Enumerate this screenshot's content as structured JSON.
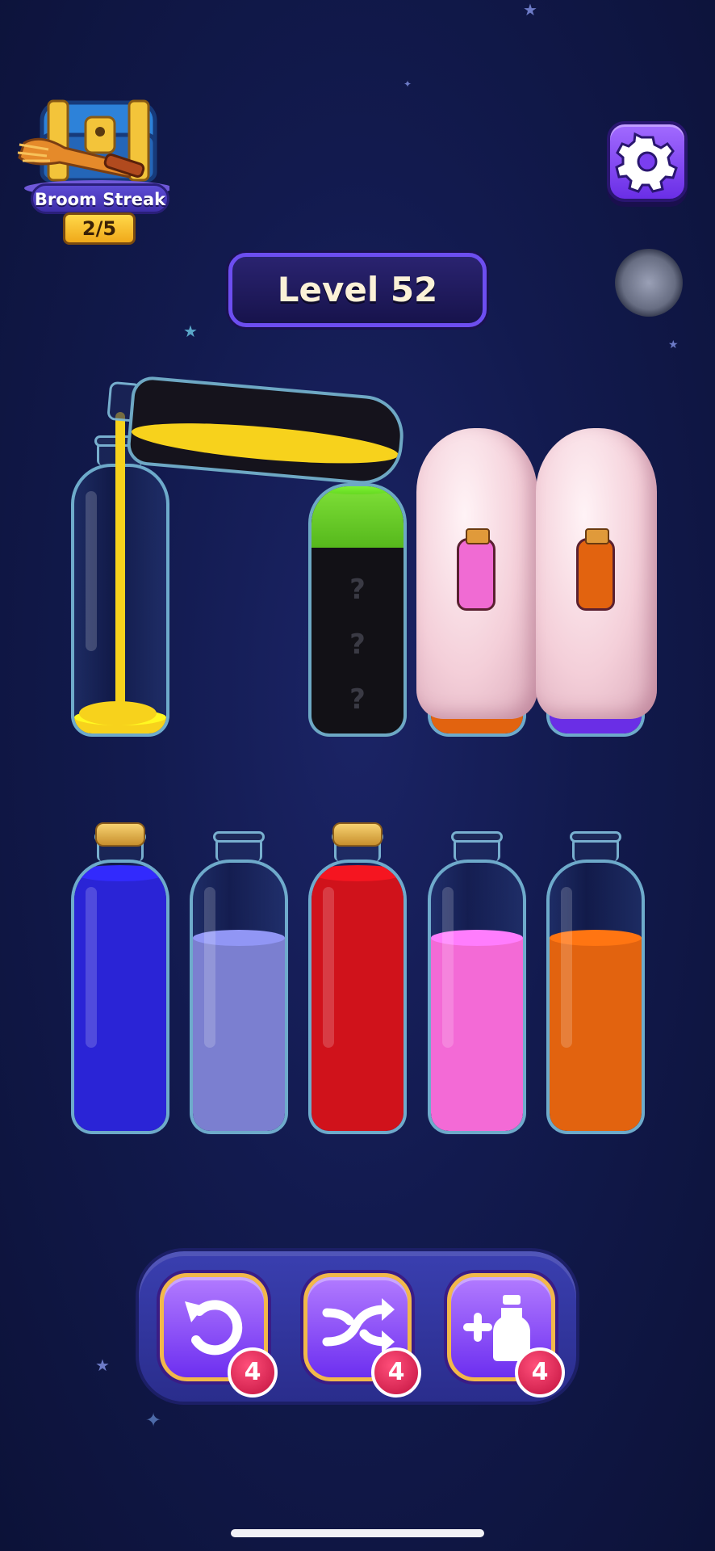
{
  "streak": {
    "title": "Broom Streak",
    "count": "2/5"
  },
  "level": {
    "label": "Level 52"
  },
  "icons": {
    "settings": "gear-icon",
    "streak": "treasure-chest-icon",
    "undo": "undo-icon",
    "shuffle": "shuffle-icon",
    "add_bottle": "add-bottle-icon"
  },
  "boosters": [
    {
      "name": "undo",
      "count": "4"
    },
    {
      "name": "shuffle",
      "count": "4"
    },
    {
      "name": "add-bottle",
      "count": "4"
    }
  ],
  "hidden_marks": [
    "?",
    "?",
    "?"
  ],
  "bottles_top": [
    {
      "id": "pour-target",
      "liquid": "#f7d21c",
      "fill": 0.05
    },
    {
      "id": "mystery",
      "liquid": "#6cd02b",
      "fill": 0.25
    },
    {
      "id": "covered-pink",
      "hint_color": "#f06bd3"
    },
    {
      "id": "covered-orange",
      "hint_color": "#e2630f"
    }
  ],
  "bottles_bottom": [
    {
      "id": "blue",
      "liquid": "#2a24d6",
      "fill": 1.0,
      "corked": true
    },
    {
      "id": "lavender",
      "liquid": "#7b7fd0",
      "fill": 0.75,
      "corked": false
    },
    {
      "id": "red",
      "liquid": "#d0121b",
      "fill": 1.0,
      "corked": true
    },
    {
      "id": "pink",
      "liquid": "#f36ad6",
      "fill": 0.75,
      "corked": false
    },
    {
      "id": "orange",
      "liquid": "#e2630f",
      "fill": 0.75,
      "corked": false
    }
  ],
  "colors": {
    "accent": "#6d4ef0",
    "badge": "#d51a47",
    "gold": "#f2b84a"
  }
}
